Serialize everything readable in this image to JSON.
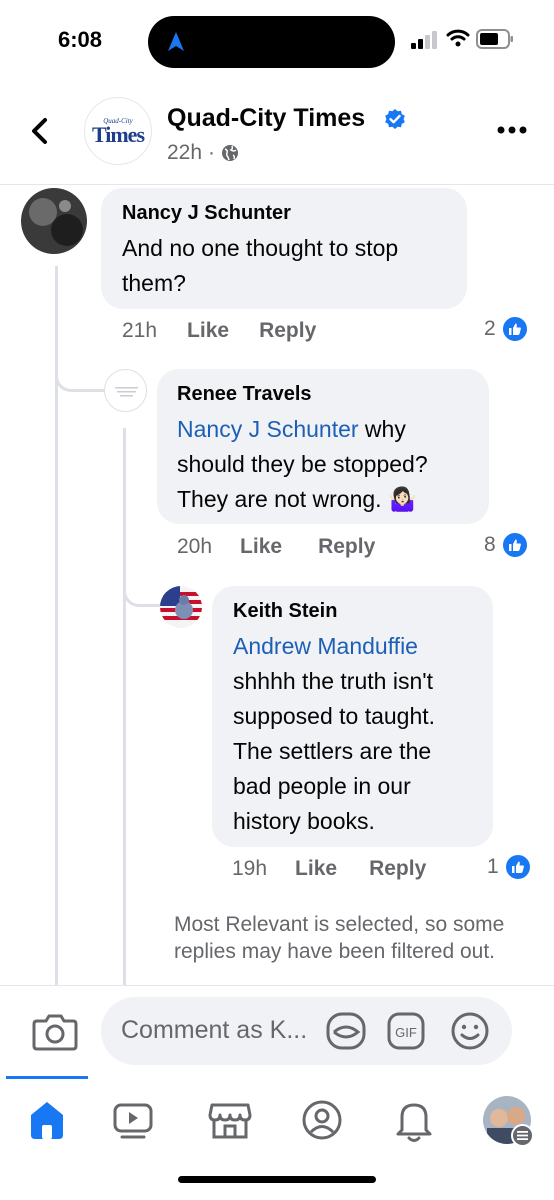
{
  "status_bar": {
    "time": "6:08"
  },
  "header": {
    "page_name": "Quad-City Times",
    "logo_small": "Quad-City",
    "logo_big": "Times",
    "post_age": "22h",
    "separator": "·"
  },
  "comments": [
    {
      "author": "Nancy J Schunter",
      "text": "And no one thought to stop them?",
      "time": "21h",
      "like_label": "Like",
      "reply_label": "Reply",
      "like_count": "2"
    },
    {
      "author": "Renee Travels",
      "mention": "Nancy J Schunter",
      "text": " why should they be stopped? They are not wrong. 🤷🏻‍♀️",
      "time": "20h",
      "like_label": "Like",
      "reply_label": "Reply",
      "like_count": "8"
    },
    {
      "author": "Keith Stein",
      "mention": "Andrew Manduffie",
      "text": "shhhh the truth isn't supposed to taught. The settlers are the bad people in our history books.",
      "time": "19h",
      "like_label": "Like",
      "reply_label": "Reply",
      "like_count": "1"
    }
  ],
  "filter_notice": "Most Relevant is selected, so some replies may have been filtered out.",
  "composer": {
    "placeholder": "Comment as K...",
    "gif_label": "GIF"
  },
  "icons": {
    "status": [
      "navigation-arrow-icon",
      "cellular-signal-icon",
      "wifi-icon",
      "battery-icon"
    ],
    "header": [
      "back-chevron-icon",
      "verified-badge-icon",
      "globe-icon",
      "more-options-icon"
    ],
    "composer": [
      "camera-icon",
      "sticker-icon",
      "gif-icon",
      "emoji-icon"
    ],
    "tabs": [
      "home-icon",
      "video-icon",
      "marketplace-icon",
      "profile-icon",
      "notifications-bell-icon",
      "menu-icon"
    ]
  },
  "colors": {
    "accent": "#1877f2",
    "mention": "#1d5fb6",
    "bubble": "#f0f2f5",
    "secondary_text": "#65676b"
  }
}
